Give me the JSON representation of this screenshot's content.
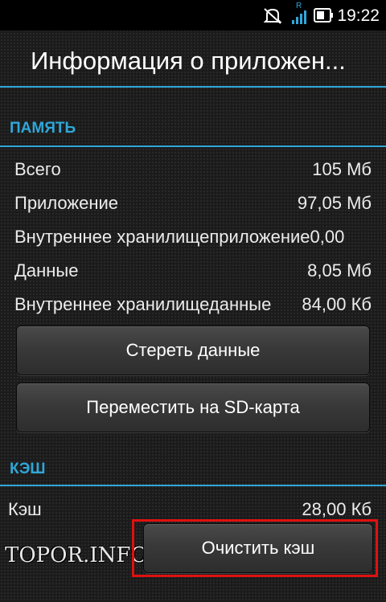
{
  "status_bar": {
    "time": "19:22",
    "roaming_indicator": "R",
    "icons": [
      "mute-icon",
      "signal-icon",
      "battery-icon"
    ]
  },
  "header": {
    "title": "Информация о приложен..."
  },
  "colors": {
    "accent": "#2fa7d8",
    "highlight": "#e01010"
  },
  "memory": {
    "header": "ПАМЯТЬ",
    "rows": [
      {
        "label": "Всего",
        "value": "105 Мб"
      },
      {
        "label": "Приложение",
        "value": "97,05 Мб"
      },
      {
        "label": "Внутреннее хранилищеприложение",
        "value": "0,00"
      },
      {
        "label": "Данные",
        "value": "8,05 Мб"
      },
      {
        "label": "Внутреннее хранилищеданные",
        "value": "84,00 Кб"
      }
    ],
    "clear_data_label": "Стереть данные",
    "move_sd_label": "Переместить на SD-карта"
  },
  "cache": {
    "header": "КЭШ",
    "label": "Кэш",
    "value": "28,00 Кб",
    "clear_cache_label": "Очистить кэш"
  },
  "watermark": "TOPOR.INFO"
}
